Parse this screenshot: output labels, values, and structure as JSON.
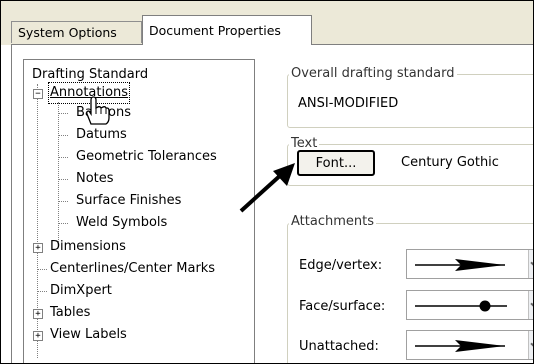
{
  "tabs": [
    {
      "label": "System Options",
      "active": false
    },
    {
      "label": "Document Properties",
      "active": true
    }
  ],
  "tree": {
    "root": "Drafting Standard",
    "annotations": {
      "label": "Annotations",
      "expander": "−",
      "children": [
        "Balloons",
        "Datums",
        "Geometric Tolerances",
        "Notes",
        "Surface Finishes",
        "Weld Symbols"
      ]
    },
    "items": [
      {
        "label": "Dimensions",
        "expander": "+"
      },
      {
        "label": "Centerlines/Center Marks",
        "expander": ""
      },
      {
        "label": "DimXpert",
        "expander": ""
      },
      {
        "label": "Tables",
        "expander": "+"
      },
      {
        "label": "View Labels",
        "expander": "+"
      }
    ]
  },
  "overall": {
    "title": "Overall drafting standard",
    "value": "ANSI-MODIFIED"
  },
  "text_group": {
    "title": "Text",
    "font_button": "Font...",
    "font_name": "Century Gothic"
  },
  "attachments": {
    "title": "Attachments",
    "rows": [
      {
        "label": "Edge/vertex:",
        "symbol": "arrow-icon"
      },
      {
        "label": "Face/surface:",
        "symbol": "dot-icon"
      },
      {
        "label": "Unattached:",
        "symbol": "arrow-icon"
      }
    ]
  },
  "colors": {
    "tab_bg": "#ece9d8",
    "border": "#7f7f7f",
    "group_border": "#d0d0bf"
  },
  "icons": {
    "cursor": "hand-pointer-icon",
    "callout": "callout-arrow-icon"
  }
}
